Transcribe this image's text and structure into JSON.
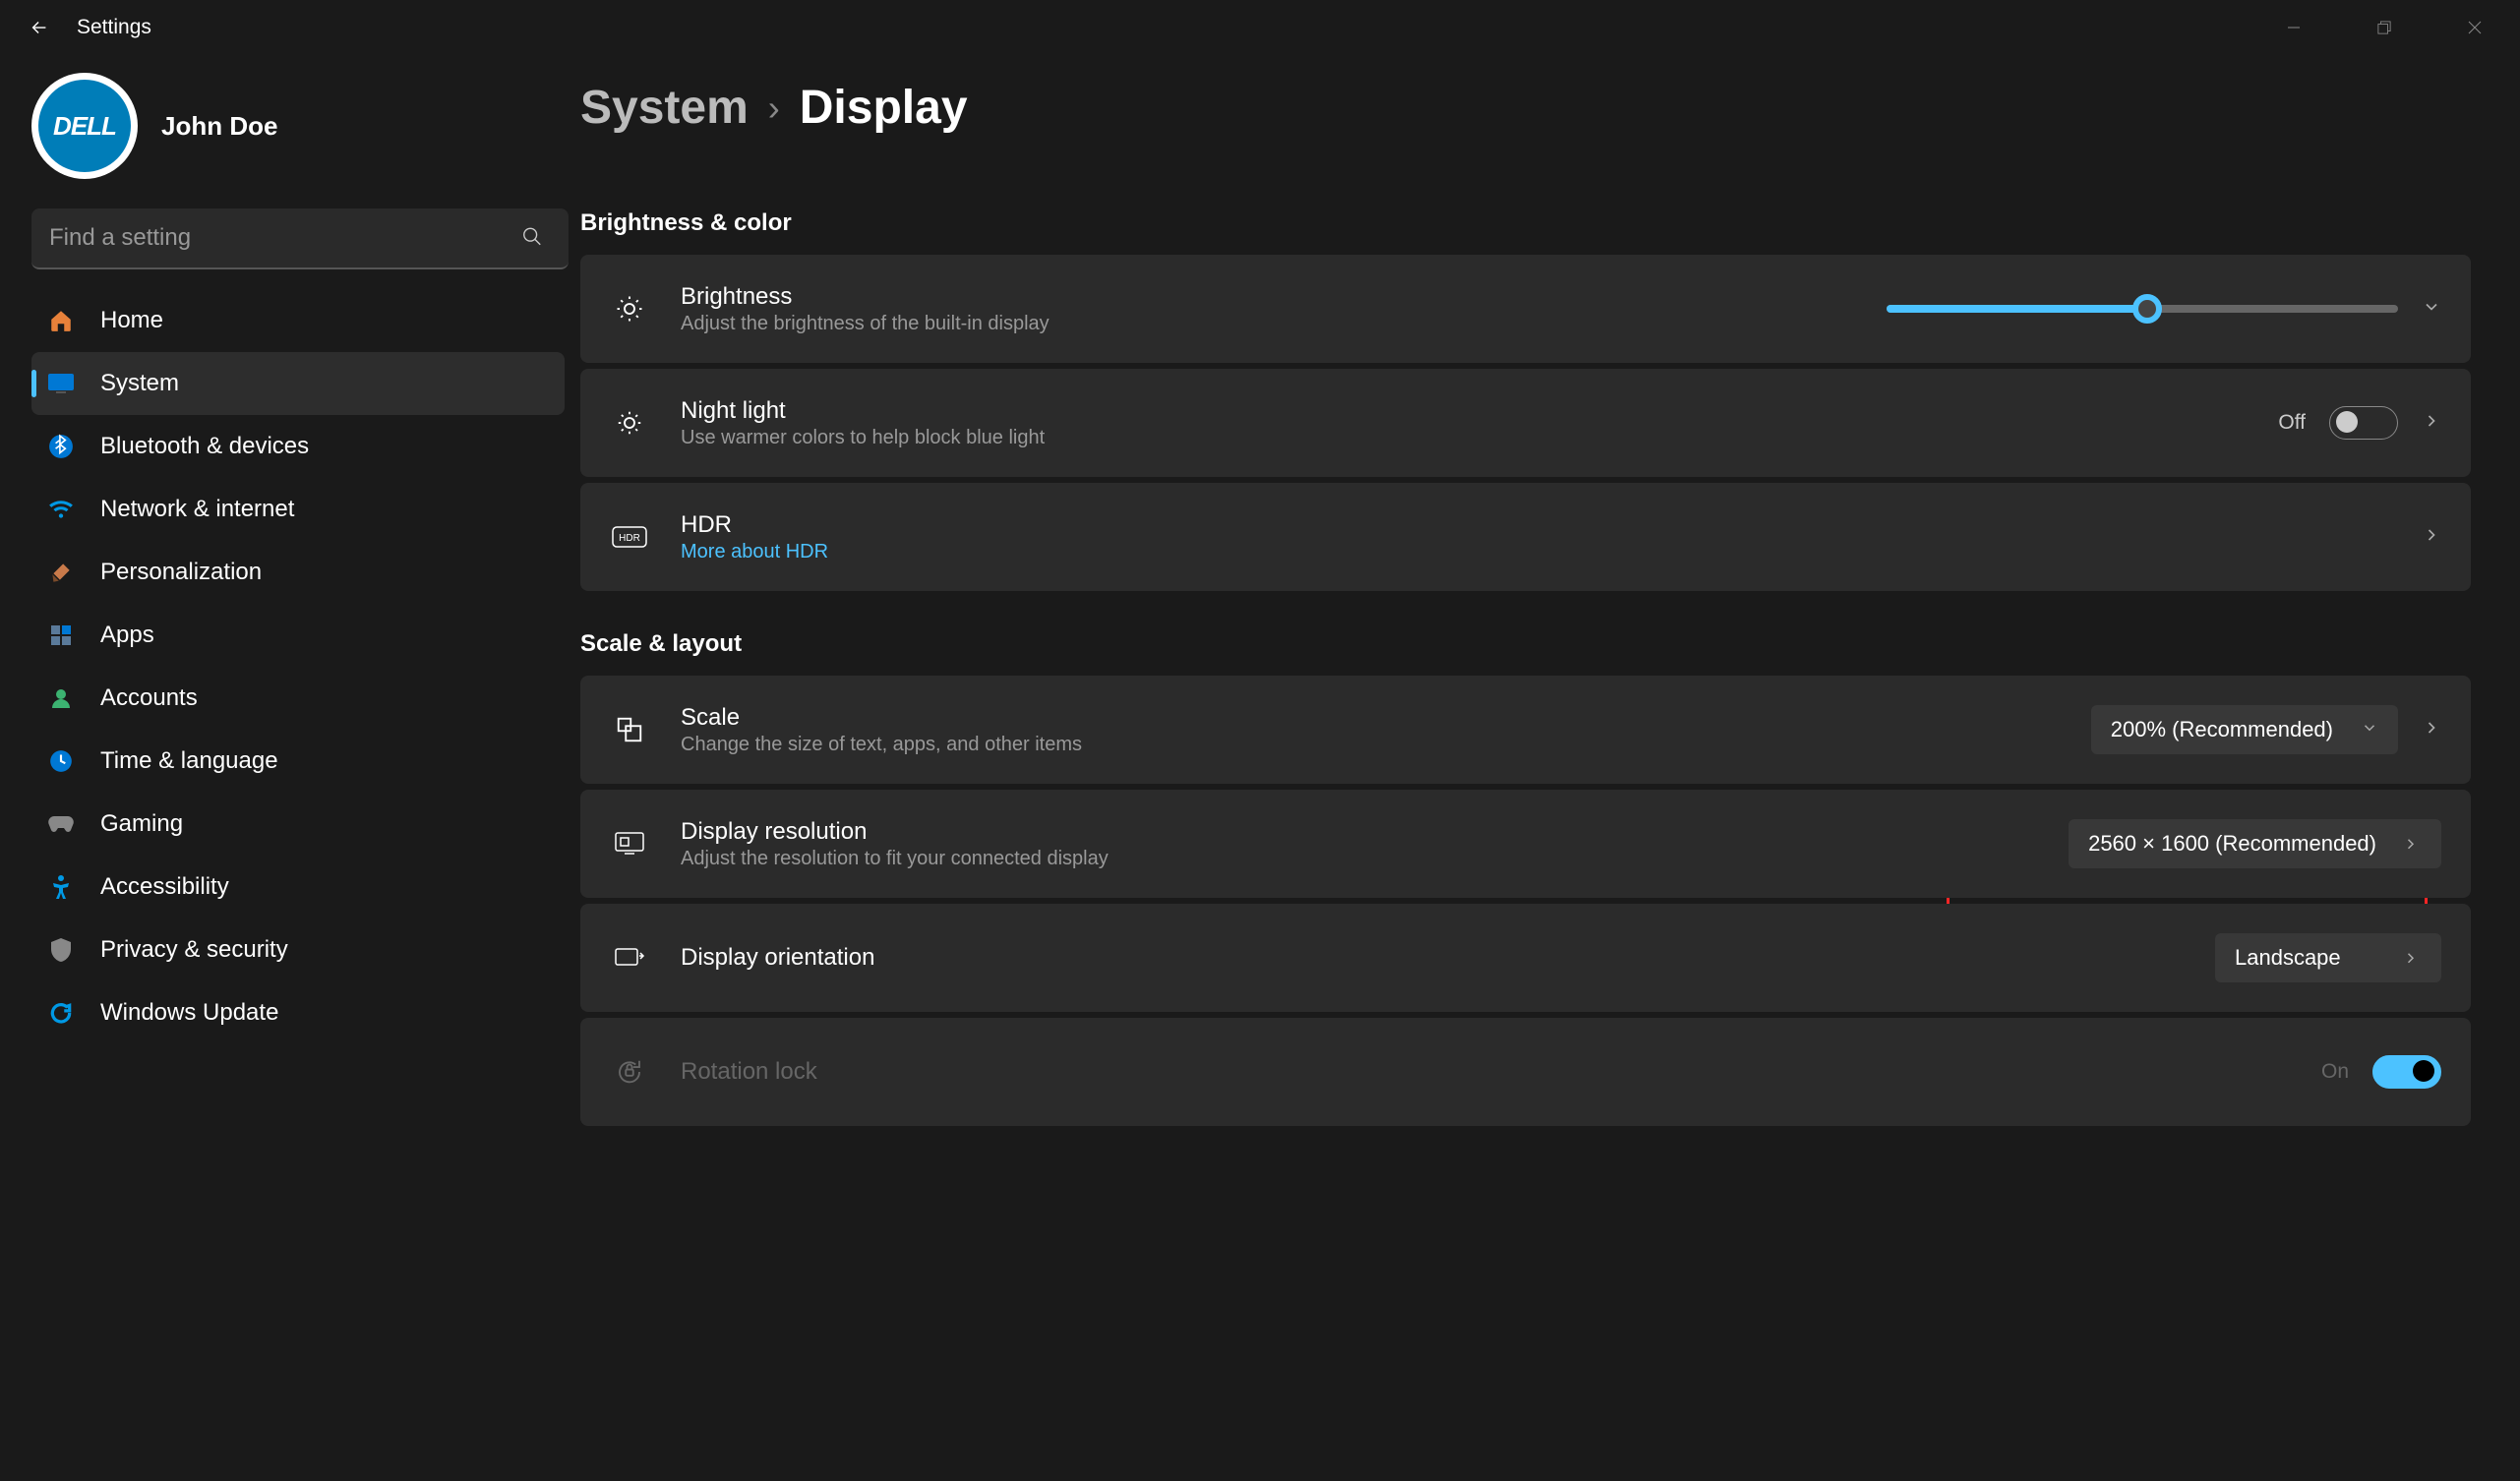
{
  "app_title": "Settings",
  "user": {
    "name": "John Doe",
    "avatar_text": "DELL"
  },
  "search": {
    "placeholder": "Find a setting"
  },
  "nav": [
    {
      "label": "Home"
    },
    {
      "label": "System"
    },
    {
      "label": "Bluetooth & devices"
    },
    {
      "label": "Network & internet"
    },
    {
      "label": "Personalization"
    },
    {
      "label": "Apps"
    },
    {
      "label": "Accounts"
    },
    {
      "label": "Time & language"
    },
    {
      "label": "Gaming"
    },
    {
      "label": "Accessibility"
    },
    {
      "label": "Privacy & security"
    },
    {
      "label": "Windows Update"
    }
  ],
  "breadcrumb": {
    "parent": "System",
    "current": "Display"
  },
  "sections": {
    "brightness_color": "Brightness & color",
    "scale_layout": "Scale & layout"
  },
  "brightness": {
    "title": "Brightness",
    "sub": "Adjust the brightness of the built-in display",
    "value_percent": 51
  },
  "nightlight": {
    "title": "Night light",
    "sub": "Use warmer colors to help block blue light",
    "state": "Off"
  },
  "hdr": {
    "title": "HDR",
    "link": "More about HDR"
  },
  "scale": {
    "title": "Scale",
    "sub": "Change the size of text, apps, and other items",
    "value": "200% (Recommended)"
  },
  "resolution": {
    "title": "Display resolution",
    "sub": "Adjust the resolution to fit your connected display",
    "value": "2560 × 1600 (Recommended)"
  },
  "orientation": {
    "title": "Display orientation",
    "value": "Landscape"
  },
  "rotation": {
    "title": "Rotation lock",
    "state": "On"
  }
}
